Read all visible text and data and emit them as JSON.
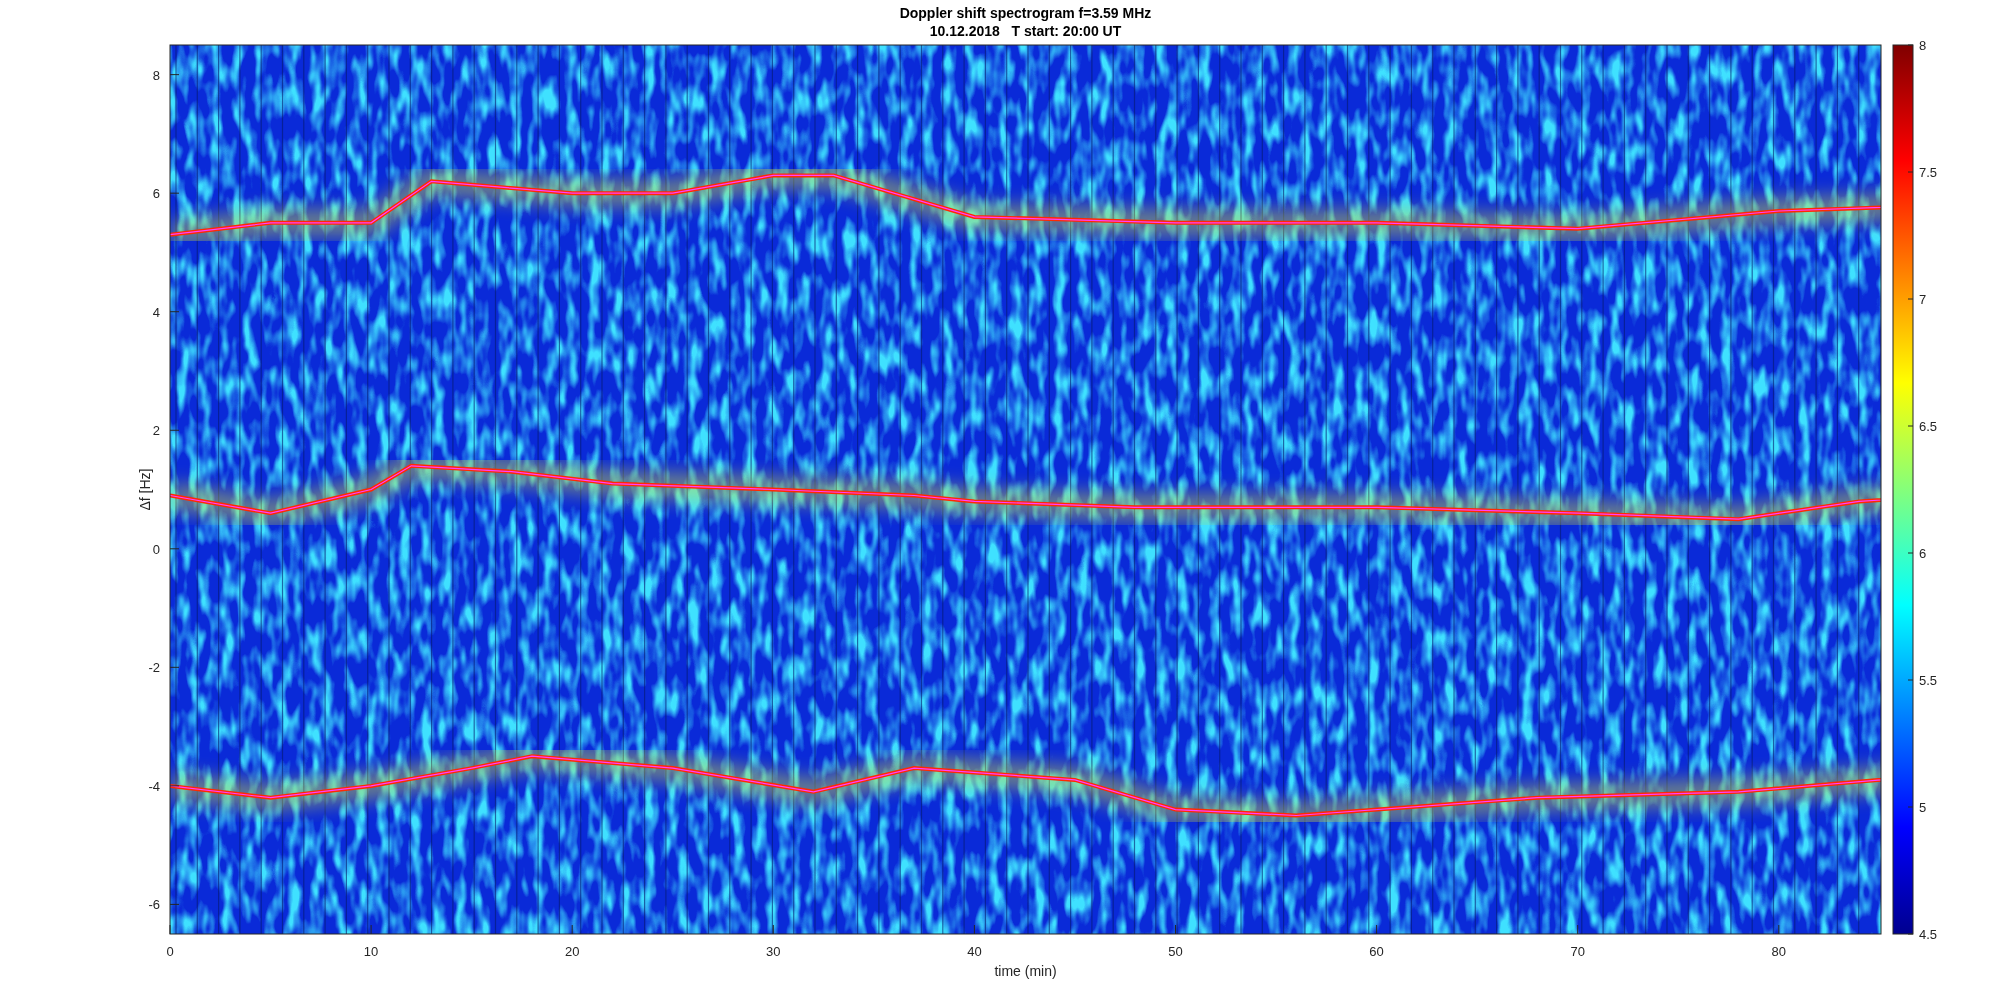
{
  "figure": {
    "title": "Doppler shift spectrogram f=3.59 MHz",
    "subtitle": "10.12.2018   T start: 20:00 UT",
    "axes": {
      "xlabel": "time (min)",
      "ylabel": "Δf [Hz]",
      "xticks": [
        "0",
        "10",
        "20",
        "30",
        "40",
        "50",
        "60",
        "70",
        "80"
      ],
      "yticks": [
        "8",
        "6",
        "4",
        "2",
        "0",
        "-2",
        "-4",
        "-6"
      ]
    },
    "colorbar": {
      "ticks": [
        "8",
        "7.5",
        "7",
        "6.5",
        "6",
        "5.5",
        "5",
        "4.5"
      ]
    }
  }
}
